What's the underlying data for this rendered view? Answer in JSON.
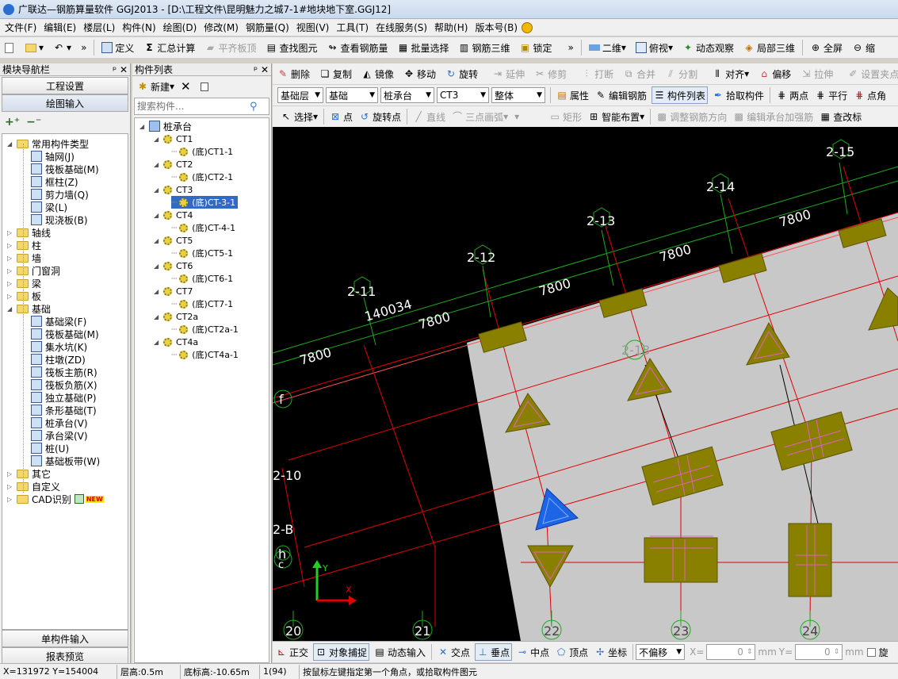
{
  "window": {
    "title": "广联达—钢筋算量软件 GGJ2013 - [D:\\工程文件\\昆明魅力之城7-1#地块地下室.GGJ12]"
  },
  "menu": [
    "文件(F)",
    "编辑(E)",
    "楼层(L)",
    "构件(N)",
    "绘图(D)",
    "修改(M)",
    "钢筋量(Q)",
    "视图(V)",
    "工具(T)",
    "在线服务(S)",
    "帮助(H)",
    "版本号(B)"
  ],
  "toolbar1": {
    "define": "定义",
    "sum": "汇总计算",
    "flat": "平齐板顶",
    "find": "查找图元",
    "view_rebar": "查看钢筋量",
    "batch": "批量选择",
    "rebar3d": "钢筋三维",
    "lock": "锁定",
    "view2d": "二维",
    "top_view": "俯视",
    "dynamic": "动态观察",
    "local3d": "局部三维",
    "fullscreen": "全屏",
    "zoom": "缩"
  },
  "toolbar2": {
    "delete": "删除",
    "copy": "复制",
    "mirror": "镜像",
    "move": "移动",
    "rotate": "旋转",
    "extend": "延伸",
    "trim": "修剪",
    "break": "打断",
    "merge": "合并",
    "split": "分割",
    "align": "对齐",
    "offset": "偏移",
    "stretch": "拉伸",
    "setpoint": "设置夹点"
  },
  "toolbar3": {
    "floor": "基础层",
    "category": "基础",
    "type": "桩承台",
    "item": "CT3",
    "scope": "整体",
    "attr": "属性",
    "edit_rebar": "编辑钢筋",
    "comp_list": "构件列表",
    "pick": "拾取构件",
    "two_pt": "两点",
    "parallel": "平行",
    "point_angle": "点角"
  },
  "toolbar4": {
    "select": "选择",
    "point": "点",
    "rotate_point": "旋转点",
    "line": "直线",
    "arc": "三点画弧",
    "rect": "矩形",
    "smart": "智能布置",
    "adjust_dir": "调整钢筋方向",
    "edit_cap": "编辑承台加强筋",
    "check": "查改标"
  },
  "left_panel": {
    "title": "模块导航栏",
    "btn_project": "工程设置",
    "btn_draw": "绘图输入",
    "btn_single": "单构件输入",
    "btn_report": "报表预览",
    "tree": [
      {
        "label": "常用构件类型",
        "kind": "folder",
        "open": true,
        "level": 0
      },
      {
        "label": "轴网(J)",
        "kind": "item",
        "level": 2
      },
      {
        "label": "筏板基础(M)",
        "kind": "item",
        "level": 2
      },
      {
        "label": "框柱(Z)",
        "kind": "item",
        "level": 2
      },
      {
        "label": "剪力墙(Q)",
        "kind": "item",
        "level": 2
      },
      {
        "label": "梁(L)",
        "kind": "item",
        "level": 2
      },
      {
        "label": "现浇板(B)",
        "kind": "item",
        "level": 2
      },
      {
        "label": "轴线",
        "kind": "folder",
        "level": 0
      },
      {
        "label": "柱",
        "kind": "folder",
        "level": 0
      },
      {
        "label": "墙",
        "kind": "folder",
        "level": 0
      },
      {
        "label": "门窗洞",
        "kind": "folder",
        "level": 0
      },
      {
        "label": "梁",
        "kind": "folder",
        "level": 0
      },
      {
        "label": "板",
        "kind": "folder",
        "level": 0
      },
      {
        "label": "基础",
        "kind": "folder",
        "open": true,
        "level": 0
      },
      {
        "label": "基础梁(F)",
        "kind": "item",
        "level": 2
      },
      {
        "label": "筏板基础(M)",
        "kind": "item",
        "level": 2
      },
      {
        "label": "集水坑(K)",
        "kind": "item",
        "level": 2
      },
      {
        "label": "柱墩(ZD)",
        "kind": "item",
        "level": 2
      },
      {
        "label": "筏板主筋(R)",
        "kind": "item",
        "level": 2
      },
      {
        "label": "筏板负筋(X)",
        "kind": "item",
        "level": 2
      },
      {
        "label": "独立基础(P)",
        "kind": "item",
        "level": 2
      },
      {
        "label": "条形基础(T)",
        "kind": "item",
        "level": 2
      },
      {
        "label": "桩承台(V)",
        "kind": "item",
        "level": 2
      },
      {
        "label": "承台梁(V)",
        "kind": "item",
        "level": 2
      },
      {
        "label": "桩(U)",
        "kind": "item",
        "level": 2
      },
      {
        "label": "基础板带(W)",
        "kind": "item",
        "level": 2
      },
      {
        "label": "其它",
        "kind": "folder",
        "level": 0
      },
      {
        "label": "自定义",
        "kind": "folder",
        "level": 0
      },
      {
        "label": "CAD识别",
        "kind": "folder",
        "level": 0,
        "badge": "NEW"
      }
    ]
  },
  "comp_panel": {
    "title": "构件列表",
    "new_btn": "新建",
    "search_placeholder": "搜索构件...",
    "root": "桩承台",
    "items": [
      {
        "name": "CT1",
        "child": "(底)CT1-1"
      },
      {
        "name": "CT2",
        "child": "(底)CT2-1"
      },
      {
        "name": "CT3",
        "child": "(底)CT-3-1",
        "selected": true
      },
      {
        "name": "CT4",
        "child": "(底)CT-4-1"
      },
      {
        "name": "CT5",
        "child": "(底)CT5-1"
      },
      {
        "name": "CT6",
        "child": "(底)CT6-1"
      },
      {
        "name": "CT7",
        "child": "(底)CT7-1"
      },
      {
        "name": "CT2a",
        "child": "(底)CT2a-1"
      },
      {
        "name": "CT4a",
        "child": "(底)CT4a-1"
      }
    ]
  },
  "canvas": {
    "axis_labels": [
      "2-11",
      "2-12",
      "2-13",
      "2-14",
      "2-15",
      "f",
      "2-10",
      "2-B",
      "h",
      "c",
      "20",
      "21",
      "22",
      "23",
      "24",
      "2-13"
    ],
    "dims": [
      "7800",
      "7800",
      "7800",
      "7800",
      "7800",
      "140034"
    ],
    "axis_x": "X",
    "axis_y": "Y"
  },
  "snapbar": {
    "ortho": "正交",
    "osnap": "对象捕捉",
    "dyn": "动态输入",
    "intersect": "交点",
    "perp": "垂点",
    "mid": "中点",
    "vertex": "顶点",
    "coord": "坐标",
    "offset_mode": "不偏移",
    "x_label": "X=",
    "x_val": "0",
    "unit1": "mm",
    "y_label": "Y=",
    "y_val": "0",
    "unit2": "mm",
    "rotate": "旋"
  },
  "status": {
    "coords": "X=131972 Y=154004",
    "floor_h": "层高:0.5m",
    "bottom_elev": "底标高:-10.65m",
    "count": "1(94)",
    "hint": "按鼠标左键指定第一个角点，或拾取构件图元"
  }
}
